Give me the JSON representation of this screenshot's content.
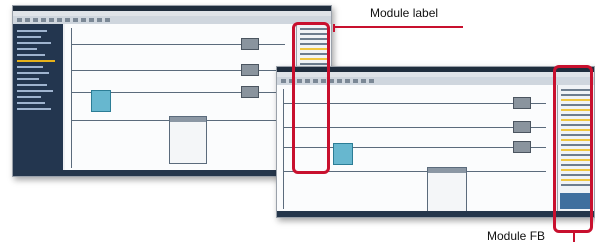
{
  "callouts": {
    "module_label": "Module label",
    "module_fb": "Module FB"
  },
  "colors": {
    "highlight": "#c8102e",
    "nav_panel": "#23364f",
    "accent_block": "#67b7cf"
  }
}
